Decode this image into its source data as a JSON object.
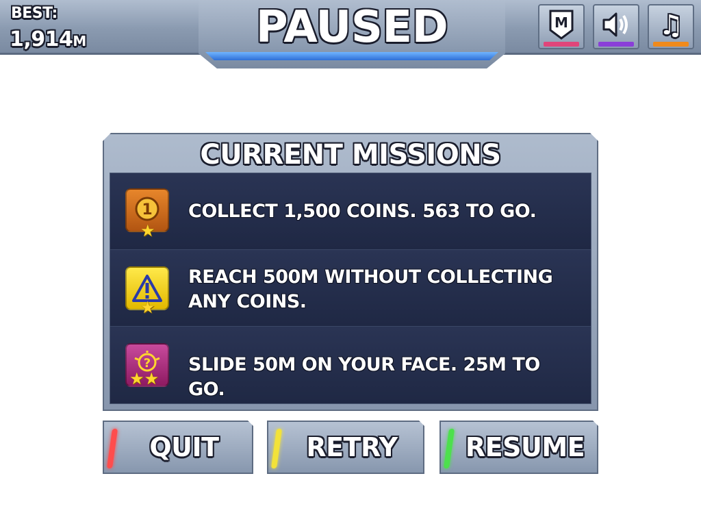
{
  "header": {
    "best_label": "BEST:",
    "best_value": "1,914",
    "best_unit": "M",
    "title": "PAUSED",
    "buttons": [
      {
        "name": "missions",
        "glyph": "M",
        "icon": "missions-badge-icon",
        "accent": "#e0457a"
      },
      {
        "name": "sound",
        "icon": "speaker-icon",
        "accent": "#8a3fd8"
      },
      {
        "name": "music",
        "glyph": "♫",
        "icon": "music-note-icon",
        "accent": "#f08a1c"
      }
    ]
  },
  "missions": {
    "title": "CURRENT MISSIONS",
    "items": [
      {
        "text": "COLLECT 1,500 COINS. 563 TO GO.",
        "icon": "coin-medal-icon",
        "icon_color": "#d9711c",
        "stars": "★"
      },
      {
        "text": "REACH 500M WITHOUT COLLECTING ANY COINS.",
        "icon": "warning-triangle-icon",
        "icon_color": "#f2d30f",
        "stars": "★"
      },
      {
        "text": "SLIDE 50M ON YOUR FACE. 25M TO GO.",
        "icon": "lightbulb-question-icon",
        "icon_color": "#b3287d",
        "stars": "★★"
      }
    ]
  },
  "actions": {
    "quit": {
      "label": "QUIT",
      "accent": "#ff4d4d"
    },
    "retry": {
      "label": "RETRY",
      "accent": "#f2e23a"
    },
    "resume": {
      "label": "RESUME",
      "accent": "#4de04d"
    }
  }
}
